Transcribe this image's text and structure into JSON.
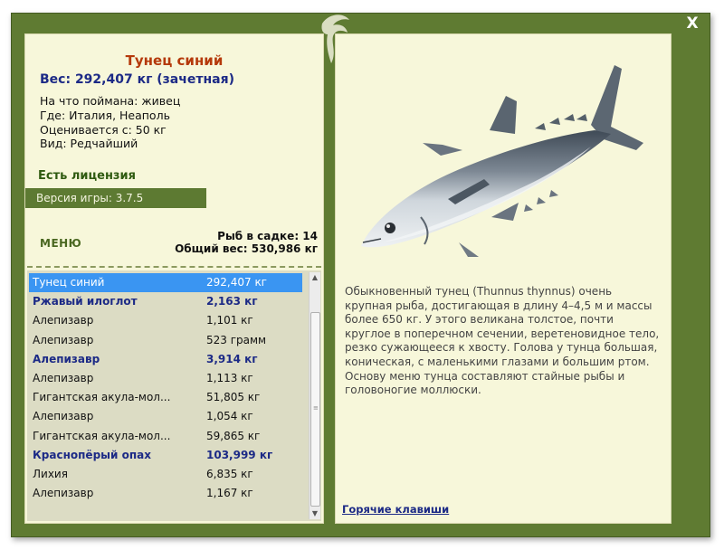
{
  "fish": {
    "name": "Тунец синий",
    "weight": "Вес: 292,407 кг (зачетная)",
    "caught_with": "На что поймана: живец",
    "location": "Где: Италия, Неаполь",
    "value": "Оценивается с: 50 кг",
    "rarity": "Вид: Редчайший",
    "license": "Есть лицензия",
    "description": "Обыкновенный тунец (Thunnus thynnus) очень крупная рыба, достигающая в длину 4–4,5 м и массы более 650 кг. У этого великана толстое, почти круглое в поперечном сечении, веретеновидное тело, резко сужающееся к хвосту. Голова у тунца большая, коническая, с маленькими глазами и большим ртом. Основу меню тунца составляют стайные рыбы и головоногие моллюски."
  },
  "version": "Версия игры: 3.7.5",
  "menu_label": "МЕНЮ",
  "stats": {
    "in_keepnet": "Рыб в садке: 14",
    "total_weight": "Общий вес: 530,986 кг"
  },
  "catch_list": [
    {
      "name": "Тунец синий",
      "weight": "292,407 кг"
    },
    {
      "name": "Ржавый илоглот",
      "weight": "2,163 кг"
    },
    {
      "name": "Алепизавр",
      "weight": "1,101 кг"
    },
    {
      "name": "Алепизавр",
      "weight": "523 грамм"
    },
    {
      "name": "Алепизавр",
      "weight": "3,914 кг"
    },
    {
      "name": "Алепизавр",
      "weight": "1,113 кг"
    },
    {
      "name": "Гигантская акула-мол...",
      "weight": "51,805 кг"
    },
    {
      "name": "Алепизавр",
      "weight": "1,054 кг"
    },
    {
      "name": "Гигантская акула-мол...",
      "weight": "59,865 кг"
    },
    {
      "name": "Краснопёрый опах",
      "weight": "103,999 кг"
    },
    {
      "name": "Лихия",
      "weight": "6,835 кг"
    },
    {
      "name": "Алепизавр",
      "weight": "1,167 кг"
    }
  ],
  "close_label": "X",
  "hotkeys_label": "Горячие клавиши",
  "icons": {
    "close": "close-icon",
    "ornament": "leaf-ornament-icon",
    "scroll_up": "scroll-up-arrow-icon",
    "scroll_down": "scroll-down-arrow-icon",
    "fish_picture": "bluefin-tuna-illustration"
  },
  "colors": {
    "frame": "#5f7b32",
    "panel": "#f7f7da",
    "title": "#b5390a",
    "accent_text": "#1c2a86",
    "selected_row": "#3a95f2"
  }
}
